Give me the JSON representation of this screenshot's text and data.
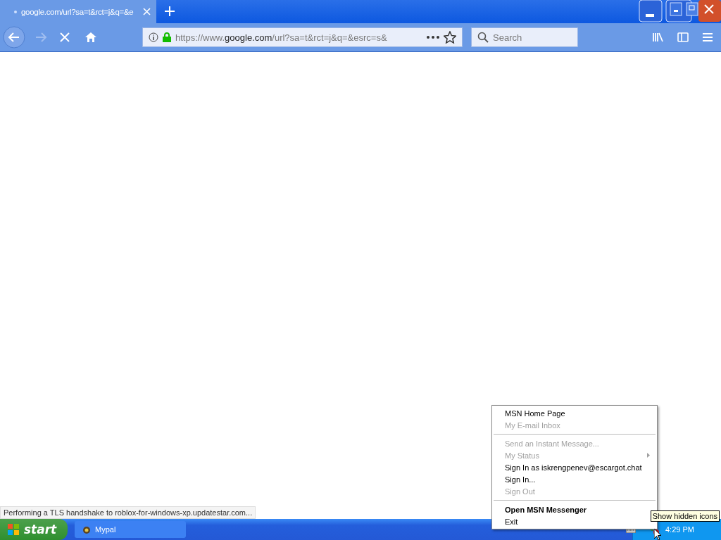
{
  "browser": {
    "tab": {
      "title": "google.com/url?sa=t&rct=j&q=&e",
      "selected": true
    },
    "url": {
      "scheme": "https://www.",
      "host": "google.com",
      "path": "/url?sa=t&rct=j&q=&esrc=s&"
    },
    "search": {
      "placeholder": "Search"
    },
    "status_text": "Performing a TLS handshake to roblox-for-windows-xp.updatestar.com..."
  },
  "context_menu": {
    "items": [
      {
        "kind": "item",
        "label": "MSN Home Page",
        "disabled": false,
        "default": false,
        "submenu": false
      },
      {
        "kind": "item",
        "label": "My E-mail Inbox",
        "disabled": true,
        "default": false,
        "submenu": false
      },
      {
        "kind": "separator"
      },
      {
        "kind": "item",
        "label": "Send an Instant Message...",
        "disabled": true,
        "default": false,
        "submenu": false
      },
      {
        "kind": "item",
        "label": "My Status",
        "disabled": true,
        "default": false,
        "submenu": true
      },
      {
        "kind": "item",
        "label": "Sign In as iskrengpenev@escargot.chat",
        "disabled": false,
        "default": false,
        "submenu": false
      },
      {
        "kind": "item",
        "label": "Sign In...",
        "disabled": false,
        "default": false,
        "submenu": false
      },
      {
        "kind": "item",
        "label": "Sign Out",
        "disabled": true,
        "default": false,
        "submenu": false
      },
      {
        "kind": "separator"
      },
      {
        "kind": "item",
        "label": "Open MSN Messenger",
        "disabled": false,
        "default": true,
        "submenu": false
      },
      {
        "kind": "item",
        "label": "Exit",
        "disabled": false,
        "default": false,
        "submenu": false
      }
    ]
  },
  "taskbar": {
    "start_label": "start",
    "tasks": [
      {
        "label": "Mypal",
        "selected": false
      }
    ],
    "clock": "4:29 PM",
    "tooltip": "Show hidden icons"
  }
}
